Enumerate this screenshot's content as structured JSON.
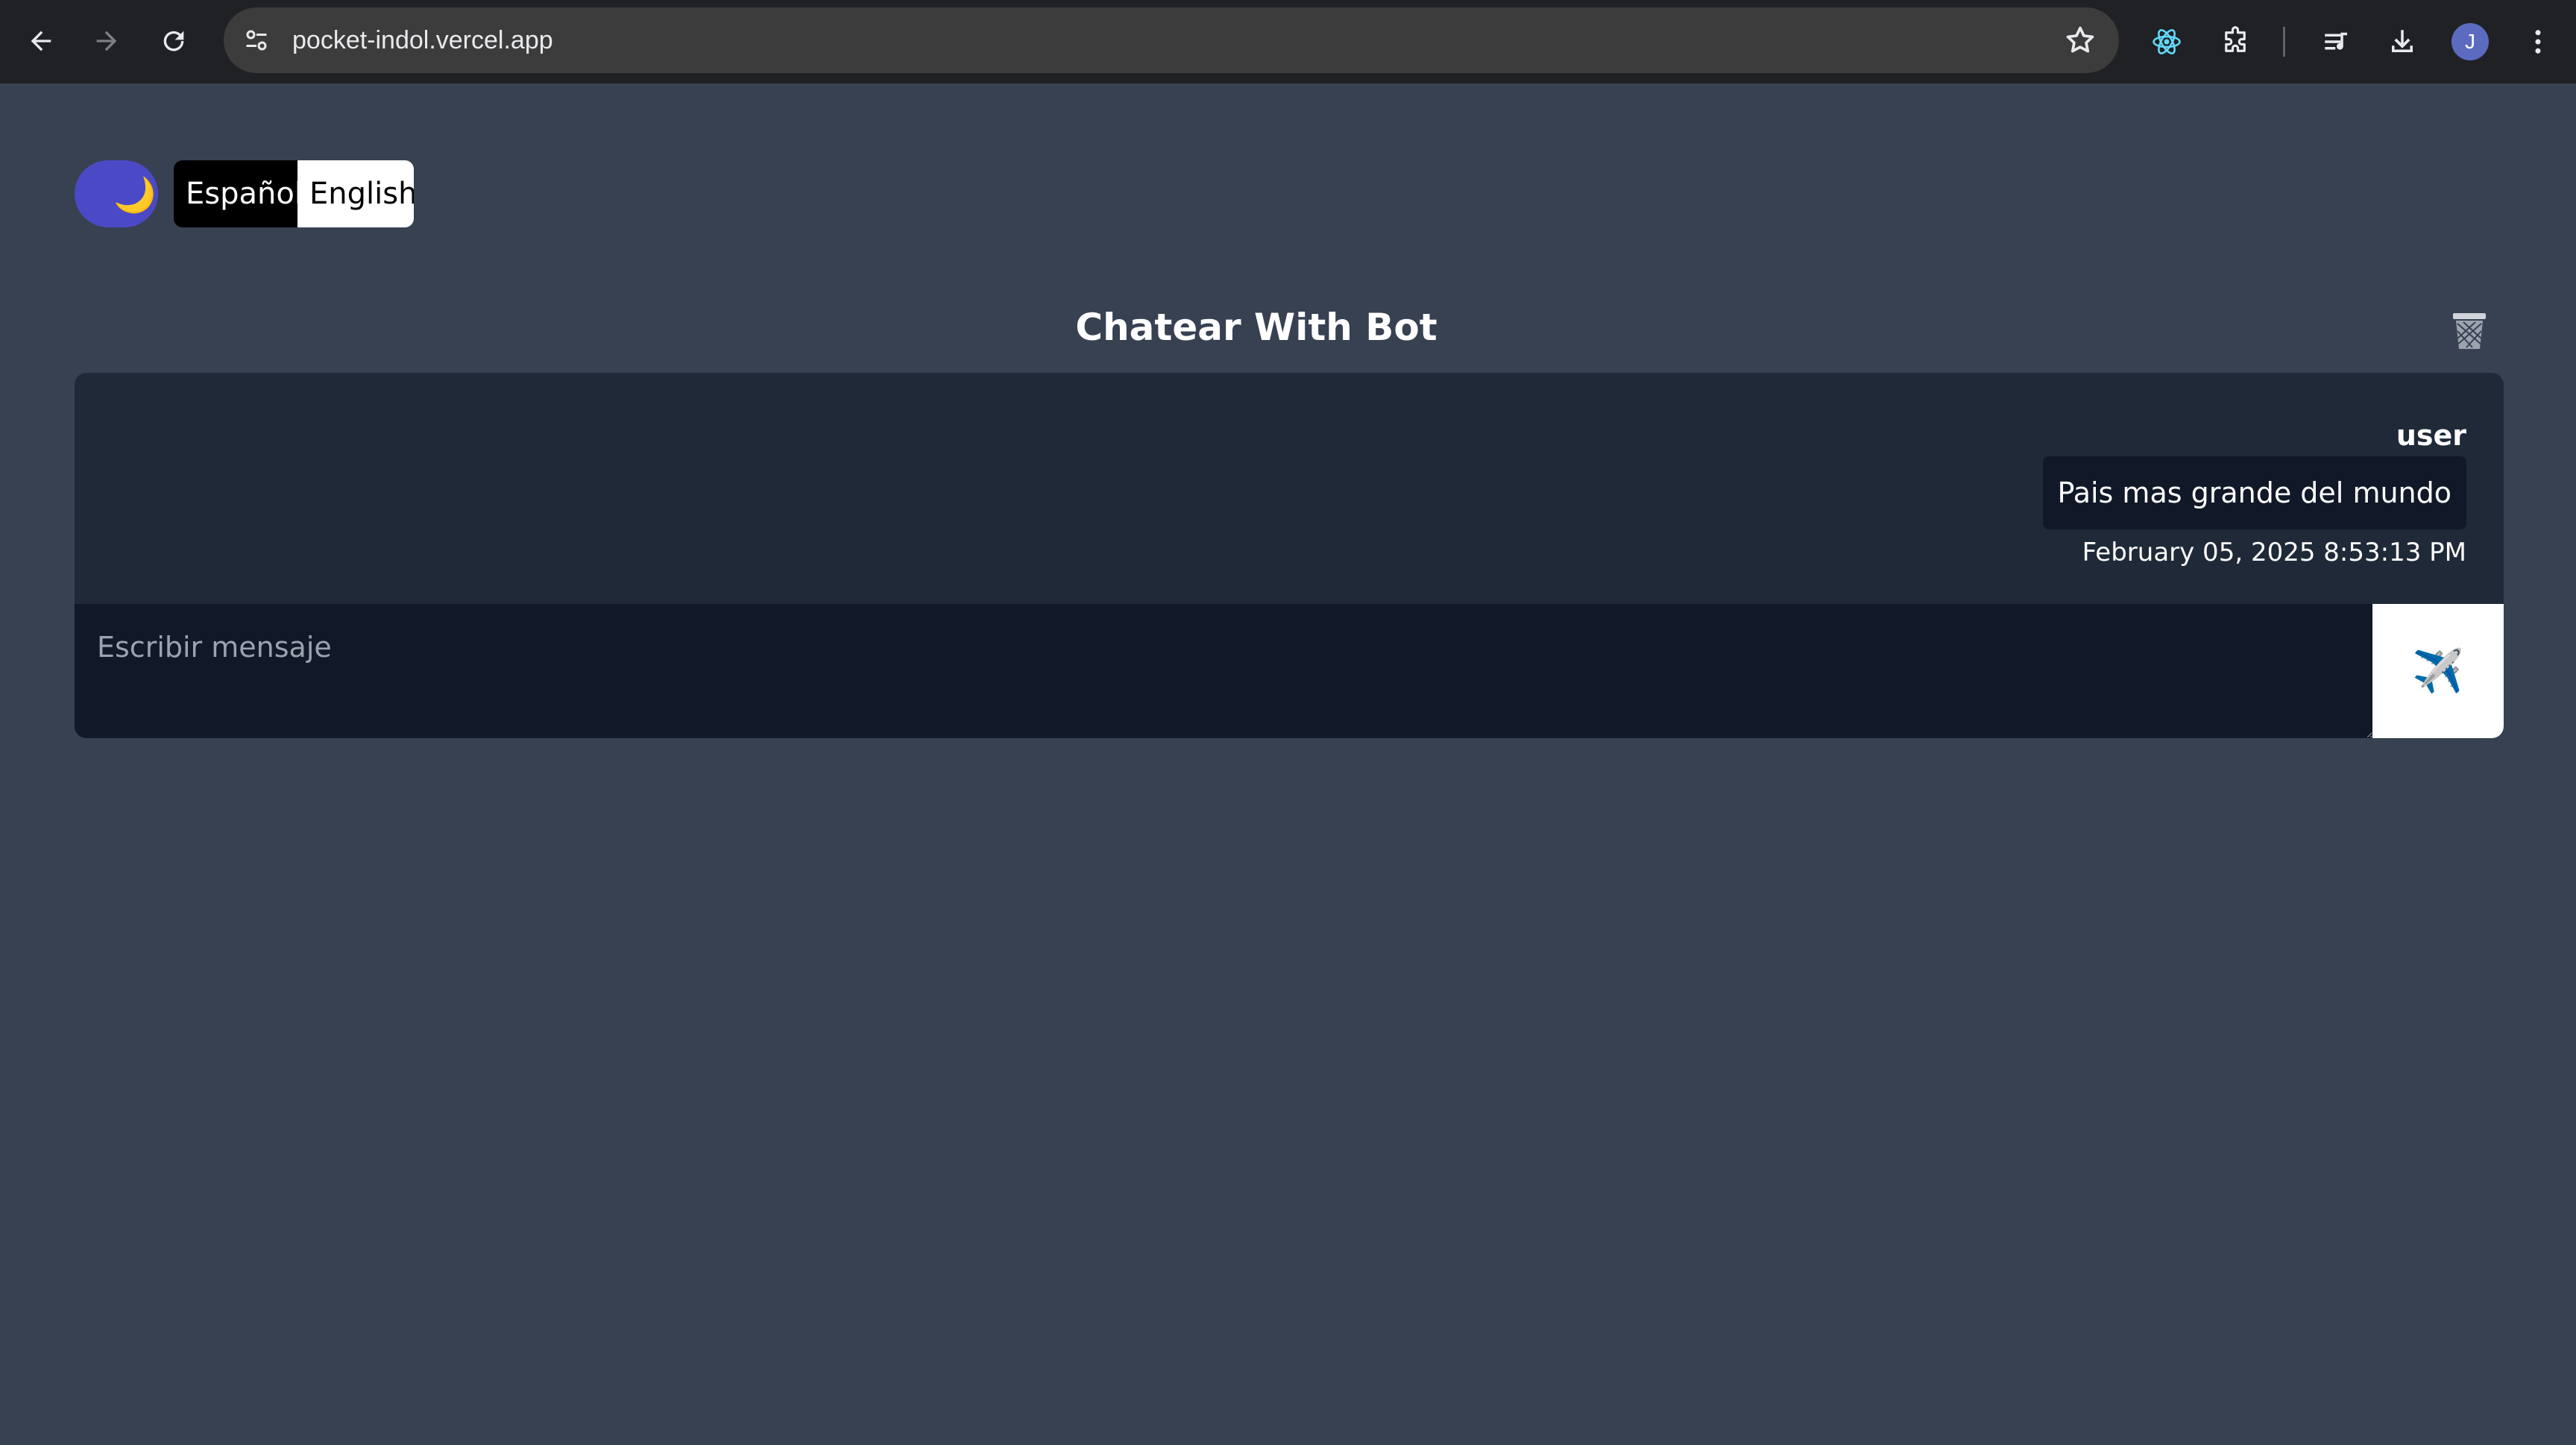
{
  "browser": {
    "url": "pocket-indol.vercel.app",
    "profile_initial": "J",
    "icons": {
      "back": "arrow-left-icon",
      "forward": "arrow-right-icon",
      "reload": "reload-icon",
      "site_info": "tune-icon",
      "bookmark": "star-icon",
      "react_devtools": "react-icon",
      "extensions": "puzzle-icon",
      "media": "queue-music-icon",
      "downloads": "download-icon",
      "menu": "kebab-menu-icon"
    }
  },
  "app": {
    "theme_toggle_icon": "🌙",
    "languages": {
      "spanish": "Español",
      "english": "English",
      "active": "Español"
    },
    "title": "Chatear With Bot",
    "clear_icon": "trash-basket-icon",
    "messages": [
      {
        "sender": "user",
        "text": "Pais mas grande del mundo",
        "timestamp": "February 05, 2025 8:53:13 PM"
      }
    ],
    "input": {
      "placeholder": "Escribir mensaje",
      "value": ""
    },
    "send_icon": "✈️"
  },
  "colors": {
    "page_bg": "#374151",
    "panel_bg": "#1f2937",
    "input_bg": "#111827",
    "toggle_bg": "#4c49c6",
    "chrome_bg": "#202124"
  }
}
